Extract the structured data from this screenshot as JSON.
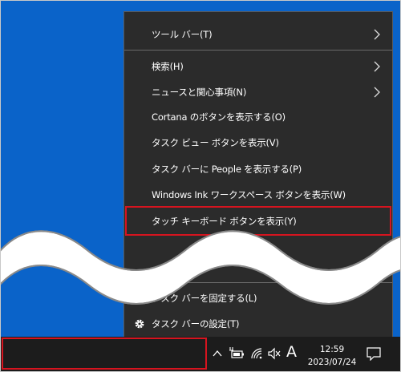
{
  "menu": {
    "items": [
      {
        "label": "ツール バー(T)",
        "submenu": true
      },
      {
        "label": "検索(H)",
        "submenu": true
      },
      {
        "label": "ニュースと関心事項(N)",
        "submenu": true
      },
      {
        "label": "Cortana のボタンを表示する(O)",
        "submenu": false
      },
      {
        "label": "タスク ビュー ボタンを表示(V)",
        "submenu": false
      },
      {
        "label": "タスク バーに People を表示する(P)",
        "submenu": false
      },
      {
        "label": "Windows Ink ワークスペース ボタンを表示(W)",
        "submenu": false
      },
      {
        "label": "タッチ キーボード ボタンを表示(Y)",
        "submenu": false,
        "highlighted": true
      },
      {
        "label": "タスク バーを固定する(L)",
        "checked": true
      },
      {
        "label": "タスク バーの設定(T)",
        "icon": "gear-icon"
      }
    ]
  },
  "taskbar": {
    "tray_icons": [
      "chevron-up-icon",
      "battery-plug-icon",
      "wifi-icon",
      "speaker-muted-icon"
    ],
    "ime_indicator": "A",
    "time": "12:59",
    "date": "2023/07/24",
    "notification_icon": "action-center-icon"
  },
  "colors": {
    "desktop": "#0a63c9",
    "menu_bg": "#2b2b2b",
    "highlight": "#d6141f",
    "taskbar": "#1c1c1c"
  }
}
